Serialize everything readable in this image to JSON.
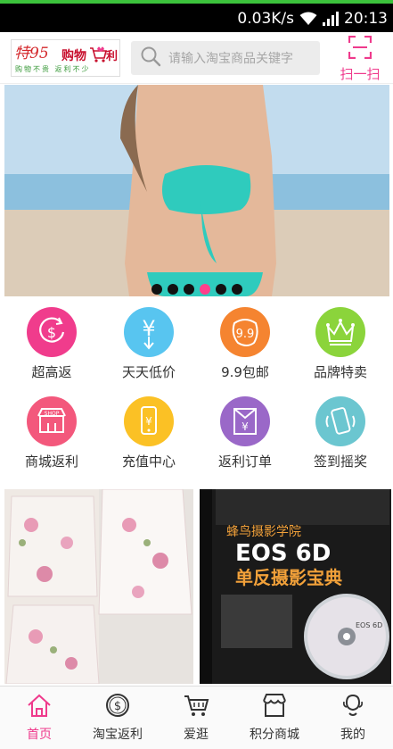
{
  "status": {
    "speed": "0.03K/s",
    "time": "20:13"
  },
  "header": {
    "logo": {
      "line1_a": "特95",
      "line1_b": "购物",
      "line1_c": "利",
      "slogan": "购物不贵 返利不少"
    },
    "search_placeholder": "请输入淘宝商品关键字",
    "scan_label": "扫一扫"
  },
  "banner": {
    "dots": 6,
    "active_dot": 3
  },
  "categories": [
    {
      "label": "超高返",
      "icon": "coin-return-icon",
      "color": "#f03c8c"
    },
    {
      "label": "天天低价",
      "icon": "yen-arrow-icon",
      "color": "#58c5f0"
    },
    {
      "label": "9.9包邮",
      "icon": "nine-nine-icon",
      "color": "#f58430"
    },
    {
      "label": "品牌特卖",
      "icon": "crown-icon",
      "color": "#8bd43b"
    },
    {
      "label": "商城返利",
      "icon": "shop-icon",
      "color": "#f3587c"
    },
    {
      "label": "充值中心",
      "icon": "phone-yen-icon",
      "color": "#fbc125"
    },
    {
      "label": "返利订单",
      "icon": "envelope-yen-icon",
      "color": "#9a68c8"
    },
    {
      "label": "签到摇奖",
      "icon": "shake-phone-icon",
      "color": "#6bc6d0"
    }
  ],
  "products": [
    {
      "name": "floral-skirt"
    },
    {
      "name": "eos-6d-book",
      "brand": "蜂鸟摄影学院",
      "title": "EOS 6D",
      "subtitle": "单反摄影宝典",
      "disc_label": "EOS 6D"
    }
  ],
  "tabbar": [
    {
      "label": "首页",
      "icon": "home-icon",
      "active": true
    },
    {
      "label": "淘宝返利",
      "icon": "dollar-circle-icon",
      "active": false
    },
    {
      "label": "爱逛",
      "icon": "cart-icon",
      "active": false
    },
    {
      "label": "积分商城",
      "icon": "store-icon",
      "active": false
    },
    {
      "label": "我的",
      "icon": "profile-icon",
      "active": false
    }
  ],
  "colors": {
    "accent": "#ef3a8c",
    "status_bar": "#000000"
  }
}
